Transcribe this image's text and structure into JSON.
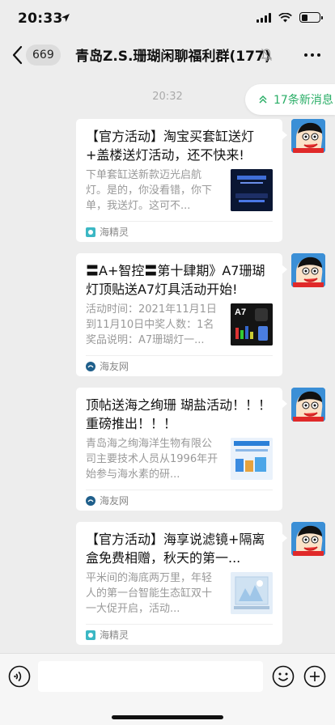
{
  "status": {
    "time": "20:33",
    "battery_level": 0.35
  },
  "nav": {
    "unread_count": "669",
    "title": "青岛Z.S.珊瑚闲聊福利群(177)"
  },
  "timestamp": "20:32",
  "new_messages": "17条新消息",
  "messages": [
    {
      "title": "【官方活动】淘宝买套缸送灯+盖楼送灯活动，还不快来!",
      "desc": "下单套缸送新款迈光启航灯。是的，你没看错，你下单，我送灯。这可不...",
      "source": "海精灵",
      "source_icon": "haijingling-icon"
    },
    {
      "title": "〓A+智控〓第十肆期》A7珊瑚灯顶贴送A7灯具活动开始!",
      "desc": "活动时间：2021年11月1日到11月10日中奖人数：1名奖品说明：A7珊瑚灯一...",
      "thumb_text": "A7",
      "source": "海友网",
      "source_icon": "haiyouwang-icon"
    },
    {
      "title": "顶帖送海之绚珊 瑚盐活动！！！ 重磅推出！！！",
      "desc": "青岛海之绚海洋生物有限公司主要技术人员从1996年开始参与海水素的研...",
      "source": "海友网",
      "source_icon": "haiyouwang-icon"
    },
    {
      "title": "【官方活动】海享说滤镜+隔离盒免费相赠，秋天的第一...",
      "desc": "平米间的海底两万里，年轻人的第一台智能生态缸双十一大促开启，活动...",
      "source": "海精灵",
      "source_icon": "haijingling-icon"
    }
  ],
  "colors": {
    "accent_green": "#2aae67",
    "background": "#ededed"
  }
}
